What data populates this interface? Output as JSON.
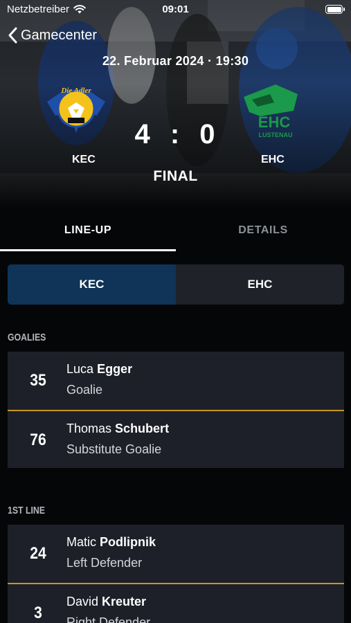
{
  "status_bar": {
    "carrier": "Netzbetreiber",
    "time": "09:01"
  },
  "nav": {
    "back_label": "Gamecenter"
  },
  "match": {
    "date": "22. Februar 2024 · 19:30",
    "home_abbr": "KEC",
    "away_abbr": "EHC",
    "home_score": "4",
    "separator": ":",
    "away_score": "0",
    "status": "FINAL",
    "home_logo_text": "Die Adler",
    "away_logo_text": "EHC",
    "away_logo_sub": "LUSTENAU"
  },
  "tabs": [
    {
      "label": "LINE-UP",
      "active": true
    },
    {
      "label": "DETAILS",
      "active": false
    }
  ],
  "team_toggle": [
    {
      "label": "KEC",
      "active": true
    },
    {
      "label": "EHC",
      "active": false
    }
  ],
  "sections": [
    {
      "title": "GOALIES",
      "players": [
        {
          "number": "35",
          "first": "Luca",
          "last": "Egger",
          "position": "Goalie"
        },
        {
          "number": "76",
          "first": "Thomas",
          "last": "Schubert",
          "position": "Substitute Goalie"
        }
      ]
    },
    {
      "title": "1ST LINE",
      "players": [
        {
          "number": "24",
          "first": "Matic",
          "last": "Podlipnik",
          "position": "Left Defender"
        },
        {
          "number": "3",
          "first": "David",
          "last": "Kreuter",
          "position": "Right Defender"
        }
      ]
    }
  ],
  "colors": {
    "accent_blue": "#0f3457",
    "divider_gold": "#c49a1d",
    "card_bg": "#1e2029",
    "home_logo_blue": "#1f4fa8",
    "home_logo_yellow": "#f4c21a",
    "away_logo_green": "#1a9a4a"
  }
}
